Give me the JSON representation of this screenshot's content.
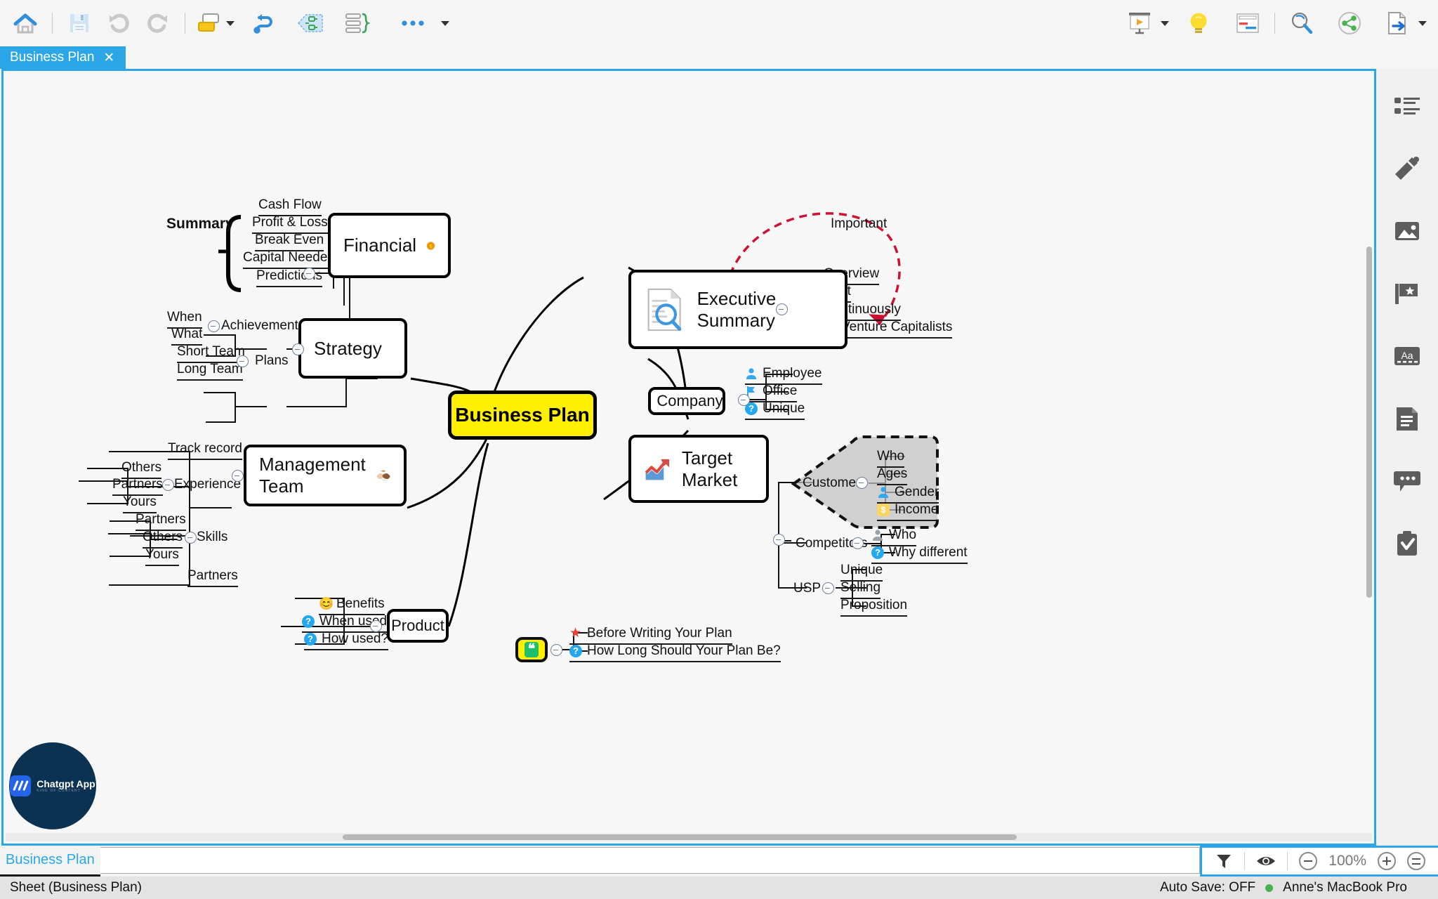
{
  "toolbar": {
    "left_buttons": [
      {
        "name": "home",
        "label": "Home"
      },
      {
        "name": "save",
        "label": "Save"
      },
      {
        "name": "undo",
        "label": "Undo"
      },
      {
        "name": "redo",
        "label": "Redo"
      },
      {
        "name": "topic",
        "label": "Topic"
      },
      {
        "name": "relationship",
        "label": "Relationship"
      },
      {
        "name": "boundary",
        "label": "Boundary"
      },
      {
        "name": "summary",
        "label": "Summary"
      },
      {
        "name": "more",
        "label": "More"
      }
    ],
    "right_buttons": [
      {
        "name": "presentation",
        "label": "Presentation"
      },
      {
        "name": "brainstorm",
        "label": "Brainstorm"
      },
      {
        "name": "gantt",
        "label": "Gantt"
      },
      {
        "name": "search",
        "label": "Search"
      },
      {
        "name": "share",
        "label": "Share"
      },
      {
        "name": "export",
        "label": "Export"
      }
    ]
  },
  "document_tab": {
    "title": "Business Plan",
    "close": "✕"
  },
  "sidebar": {
    "items": [
      {
        "name": "outline-icon",
        "label": "Outline"
      },
      {
        "name": "style-brush-icon",
        "label": "Style"
      },
      {
        "name": "image-icon",
        "label": "Image"
      },
      {
        "name": "marker-flag-icon",
        "label": "Marker"
      },
      {
        "name": "font-icon",
        "label": "Font"
      },
      {
        "name": "notes-icon",
        "label": "Notes"
      },
      {
        "name": "comment-icon",
        "label": "Comment"
      },
      {
        "name": "task-icon",
        "label": "Task"
      }
    ]
  },
  "sheetbar": {
    "tab_label": "Business Plan",
    "input_value": "",
    "zoom": "100%",
    "filter_label": "Filter",
    "eye_label": "Focus"
  },
  "statusbar": {
    "left": "Sheet (Business Plan)",
    "autosave": "Auto Save: OFF",
    "device": "Anne's MacBook Pro"
  },
  "logo": {
    "name": "Chatgpt App",
    "tagline": "KING OF CONTENT"
  },
  "mindmap": {
    "center": "Business Plan",
    "relationship_label": "Important",
    "note_topic": {
      "glyph": "❝",
      "children": [
        "Before Writing Your Plan",
        "How Long Should Your Plan Be?"
      ]
    },
    "nodes": {
      "financial": "Financial",
      "strategy": "Strategy",
      "management_team": "Management Team",
      "product": "Product",
      "executive_summary": "Executive Summary",
      "company": "Company",
      "target_market": "Target Market"
    },
    "summary_label": "Summary",
    "financial_children": [
      "Cash Flow",
      "Profit & Loss",
      "Break Even",
      "Capital Needed",
      "Predictions"
    ],
    "strategy_children": [
      {
        "label": "Achievements",
        "children": [
          "When",
          "What"
        ]
      },
      {
        "label": "Plans",
        "children": [
          "Short Team",
          "Long Team"
        ]
      }
    ],
    "management_children": [
      {
        "label": "Track record"
      },
      {
        "label": "Experience",
        "children": [
          "Others",
          "Partners",
          "Yours"
        ]
      },
      {
        "label": "Skills",
        "children": [
          "Partners",
          "Others",
          "Yours"
        ]
      },
      {
        "label": "Partners"
      }
    ],
    "product_children": [
      "Benefits",
      "When used?",
      "How used?"
    ],
    "executive_children": [
      "Overview",
      "Last",
      "Continuously",
      "Venture Capitalists"
    ],
    "company_children": [
      "Employee",
      "Office",
      "Unique"
    ],
    "target_children": [
      {
        "label": "Customers",
        "children": [
          "Who",
          "Ages",
          "Gender",
          "Income"
        ]
      },
      {
        "label": "Competitors",
        "children": [
          "Who",
          "Why different"
        ]
      },
      {
        "label": "USP",
        "children": [
          "Unique",
          "Selling",
          "Proposition"
        ]
      }
    ]
  }
}
